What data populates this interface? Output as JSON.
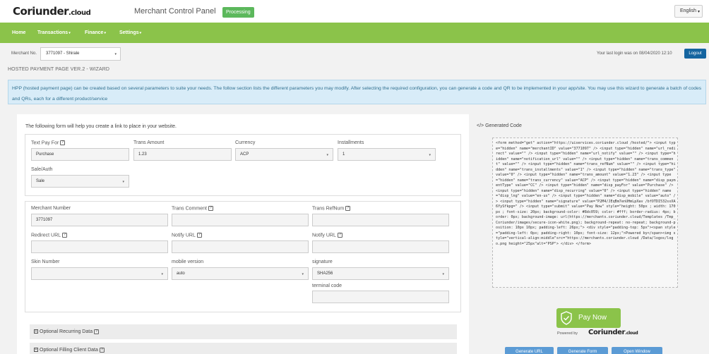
{
  "header": {
    "logo_text": "Coriunder",
    "logo_tld": ".cloud",
    "panel_title": "Merchant Control Panel",
    "status_badge": "Processing",
    "language": "English"
  },
  "nav": {
    "items": [
      {
        "label": "Home",
        "dropdown": false
      },
      {
        "label": "Transactions",
        "dropdown": true
      },
      {
        "label": "Finance",
        "dropdown": true
      },
      {
        "label": "Settings",
        "dropdown": true
      }
    ]
  },
  "merchant_bar": {
    "label": "Merchant No.",
    "selected": "3771097 - Shirale",
    "last_login_text": "Your last login was on  08/04/2020 12:10",
    "logout_label": "Logout"
  },
  "page": {
    "title": "HOSTED PAYMENT PAGE VER.2 - WIZARD",
    "info": "HPP (hosted payment page) can be created based on several parameters to suite your needs. The follow section lists the different parameters you may modify. After selecting the required configuration, you can generate a code and QR to be implemented in your app/site. You may use this wizard to generate a batch of codes and QRs, each for a different product/service"
  },
  "form": {
    "intro": "The following form will help you create a link to place in your website.",
    "text_pay_for": {
      "label": "Text Pay For",
      "value": "Purchase"
    },
    "trans_amount": {
      "label": "Trans Amount",
      "value": "1.23"
    },
    "currency": {
      "label": "Currency",
      "value": "ACP"
    },
    "installments": {
      "label": "Installments",
      "value": "1"
    },
    "sale_auth": {
      "label": "Sale/Auth",
      "value": "Sale"
    },
    "merchant_number": {
      "label": "Merchant Number",
      "value": "3771097"
    },
    "trans_comment": {
      "label": "Trans Comment",
      "value": ""
    },
    "trans_refnum": {
      "label": "Trans RefNum",
      "value": ""
    },
    "redirect_url": {
      "label": "Redirect URL",
      "value": ""
    },
    "notify_url": {
      "label": "Notify URL",
      "value": ""
    },
    "notify_url_2": {
      "label": "Notify URL",
      "value": ""
    },
    "skin_number": {
      "label": "Skin Number",
      "value": ""
    },
    "mobile_version": {
      "label": "mobile version",
      "value": "auto"
    },
    "signature": {
      "label": "signature",
      "value": "SHA256"
    },
    "terminal_code": {
      "label": "terminal code",
      "value": ""
    },
    "sections": [
      "Optional Recurring Data",
      "Optional Filling Client Data"
    ]
  },
  "generated": {
    "title": "Generated Code",
    "code": "<form method=\"get\" action=\"https://uiservices.coriunder.cloud /hosted/\"> <input type=\"hidden\" name=\"merchantID\" value=\"3771097\" /> <input type=\"hidden\" name=\"url_redirect\" value=\"\" /> <input type=\"hidden\" name=\"url_notify\" value=\"\" /> <input type=\"hidden\" name=\"notification_url\" value=\"\" /> <input type=\"hidden\" name=\"trans_comment\" value=\"\" /> <input type=\"hidden\" name=\"trans_refNum\" value=\"\" /> <input type=\"hidden\" name=\"trans_installments\" value=\"1\" /> <input type=\"hidden\" name=\"trans_type\" value=\"0\" /> <input type=\"hidden\" name=\"trans_amount\" value=\"1.23\" /> <input type=\"hidden\" name=\"trans_currency\" value=\"ACP\" /> <input type=\"hidden\" name=\"disp_paymentType\" value=\"CC\" /> <input type=\"hidden\" name=\"disp_payFor\" value=\"Purchase\" /> <input type=\"hidden\" name=\"disp_recurring\" value=\"0\" /> <input type=\"hidden\" name=\"disp_lng\" value=\"en-us\" /> <input type=\"hidden\" name=\"disp_mobile\" value=\"auto\" /> <input type=\"hidden\" name=\"signature\" value=\"P2M4/JEqBm7enUHmLpXav /bfOTDI532sxXA6YySfkpg=\" /> <input type=\"submit\" value=\"Pay Now\" style=\"height: 50px ; width: 170px ; font-size: 20px; background-color: #8dc059; color: #fff; border-radius: 4px; border: 0px; background-image: url(https://merchants.coriunder.cloud/Templates /Tmp_Coriunder/images/secure-icon-white.png); background-repeat: no-repeat; background-position: 10px 10px; padding-left: 26px;\"> <div style=\"padding-top: 5px\"><span style=\"padding-left: 0px; padding-right: 10px; font-size: 12px;\">Powered by</span><img style=\"vertical-align:middle\"src=\"https://merchants.coriunder.cloud /Data/logos/logo.png height=\"25px\"alt=\"PSP\"> </div> </form>",
    "pay_now_label": "Pay Now",
    "powered_by": "Powered by",
    "powered_logo": "Coriunder",
    "powered_logo_tld": ".cloud",
    "buttons": [
      "Generate URL",
      "Generate Form",
      "Open Window"
    ]
  },
  "colors": {
    "accent_green": "#8bc34a",
    "badge_green": "#5cb85c",
    "logout_blue": "#1565a0",
    "info_bg": "#d8ecf8"
  }
}
